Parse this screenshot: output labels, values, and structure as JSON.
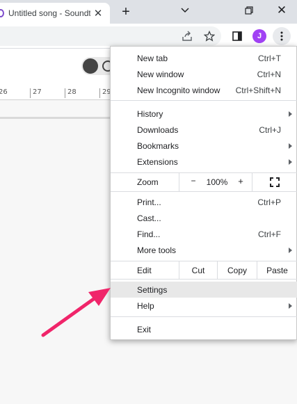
{
  "tab": {
    "title": "Untitled song - Soundtrap",
    "close_glyph": "✕"
  },
  "new_tab_glyph": "+",
  "window_controls": {
    "minimize_icon": "chevron-down-icon",
    "restore_icon": "restore-icon",
    "close_glyph": "✕"
  },
  "toolbar": {
    "avatar_letter": "J",
    "avatar_color": "#a142f4"
  },
  "ruler": {
    "ticks": [
      "26",
      "27",
      "28",
      "29"
    ]
  },
  "menu": {
    "group1": [
      {
        "label": "New tab",
        "shortcut": "Ctrl+T"
      },
      {
        "label": "New window",
        "shortcut": "Ctrl+N"
      },
      {
        "label": "New Incognito window",
        "shortcut": "Ctrl+Shift+N"
      }
    ],
    "group2": [
      {
        "label": "History",
        "submenu": true
      },
      {
        "label": "Downloads",
        "shortcut": "Ctrl+J"
      },
      {
        "label": "Bookmarks",
        "submenu": true
      },
      {
        "label": "Extensions",
        "submenu": true
      }
    ],
    "zoom": {
      "label": "Zoom",
      "minus": "−",
      "value": "100%",
      "plus": "+"
    },
    "group3": [
      {
        "label": "Print...",
        "shortcut": "Ctrl+P"
      },
      {
        "label": "Cast..."
      },
      {
        "label": "Find...",
        "shortcut": "Ctrl+F"
      },
      {
        "label": "More tools",
        "submenu": true
      }
    ],
    "edit": {
      "label": "Edit",
      "cut": "Cut",
      "copy": "Copy",
      "paste": "Paste"
    },
    "group4": [
      {
        "label": "Settings",
        "highlighted": true
      },
      {
        "label": "Help",
        "submenu": true
      }
    ],
    "exit": {
      "label": "Exit"
    }
  },
  "annotation": {
    "arrow_color": "#f0256a"
  }
}
